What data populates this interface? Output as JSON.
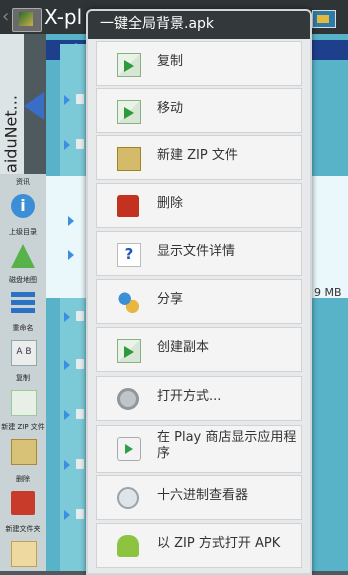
{
  "app": {
    "back_glyph": "‹",
    "title": "X-pl"
  },
  "left_tab": {
    "label": "BaiduNet..."
  },
  "path_bar": {
    "separator": "/"
  },
  "sidebar": {
    "items": [
      {
        "label": "资讯",
        "icon": "info-icon"
      },
      {
        "label": "上级目录",
        "icon": "up-arrow-icon"
      },
      {
        "label": "磁盘地图",
        "icon": "disk-map-icon"
      },
      {
        "label": "重命名",
        "icon": "rename-icon"
      },
      {
        "label": "复制",
        "icon": "copy-icon"
      },
      {
        "label": "新建 ZIP 文件",
        "icon": "zip-icon"
      },
      {
        "label": "删除",
        "icon": "trash-icon"
      },
      {
        "label": "新建文件夹",
        "icon": "new-folder-icon"
      }
    ]
  },
  "file_list": {
    "size_text": "9 MB"
  },
  "menu": {
    "title": "一键全局背景.apk",
    "items": [
      {
        "label": "复制",
        "icon": "copy-icon"
      },
      {
        "label": "移动",
        "icon": "move-icon"
      },
      {
        "label": "新建 ZIP 文件",
        "icon": "zip-icon"
      },
      {
        "label": "删除",
        "icon": "trash-icon"
      },
      {
        "label": "显示文件详情",
        "icon": "help-icon"
      },
      {
        "label": "分享",
        "icon": "share-icon"
      },
      {
        "label": "创建副本",
        "icon": "duplicate-icon"
      },
      {
        "label": "打开方式...",
        "icon": "gear-icon"
      },
      {
        "label": "在 Play 商店显示应用程序",
        "icon": "play-store-icon"
      },
      {
        "label": "十六进制查看器",
        "icon": "hex-viewer-icon"
      },
      {
        "label": "以 ZIP 方式打开 APK",
        "icon": "android-icon"
      }
    ]
  }
}
